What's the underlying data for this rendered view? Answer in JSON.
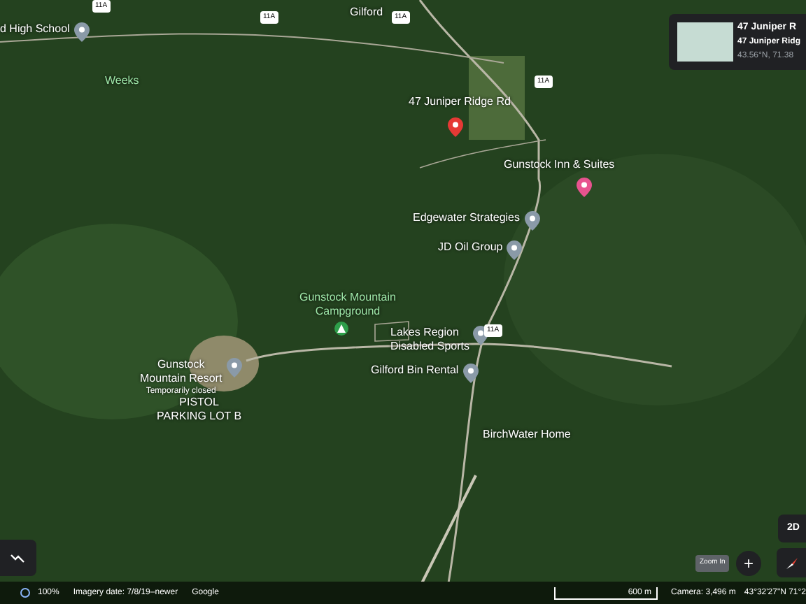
{
  "map": {
    "labels": [
      {
        "kind": "town",
        "lines": [
          "Gilford"
        ]
      },
      {
        "kind": "school",
        "lines": [
          "d High School"
        ]
      },
      {
        "kind": "area",
        "lines": [
          "Weeks"
        ]
      },
      {
        "kind": "selected",
        "lines": [
          "47 Juniper Ridge Rd"
        ]
      },
      {
        "kind": "lodging",
        "lines": [
          "Gunstock Inn & Suites"
        ]
      },
      {
        "kind": "poi",
        "lines": [
          "Edgewater Strategies"
        ]
      },
      {
        "kind": "poi",
        "lines": [
          "JD Oil Group"
        ]
      },
      {
        "kind": "campground",
        "lines": [
          "Gunstock Mountain",
          "Campground"
        ]
      },
      {
        "kind": "poi",
        "lines": [
          "Lakes Region",
          "Disabled Sports"
        ]
      },
      {
        "kind": "poi",
        "lines": [
          "Gilford Bin Rental"
        ]
      },
      {
        "kind": "resort",
        "lines": [
          "Gunstock",
          "Mountain Resort"
        ],
        "note": "Temporarily closed"
      },
      {
        "kind": "town",
        "lines": [
          "PISTOL",
          "PARKING LOT B"
        ]
      },
      {
        "kind": "town",
        "lines": [
          "BirchWater Home"
        ]
      }
    ],
    "shields": [
      "11A",
      "11A",
      "11A",
      "11A",
      "11A"
    ]
  },
  "info_card": {
    "title": "47 Juniper R",
    "subtitle": "47 Juniper Ridg",
    "coords": "43.56°N, 71.38"
  },
  "controls": {
    "mode": "2D",
    "tooltip": "Zoom In",
    "zoom": "+"
  },
  "status_bar": {
    "zoom": "100%",
    "imagery": "Imagery date: 7/8/19–newer",
    "provider": "Google",
    "scale": "600 m",
    "camera": "Camera: 3,496 m",
    "coords": "43°32'27\"N 71°2"
  }
}
